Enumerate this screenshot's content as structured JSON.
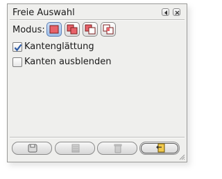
{
  "dialog": {
    "title": "Freie Auswahl",
    "modus_label": "Modus:",
    "modes": [
      {
        "icon": "replace-selection-icon",
        "active": true
      },
      {
        "icon": "add-to-selection-icon",
        "active": false
      },
      {
        "icon": "subtract-from-selection-icon",
        "active": false
      },
      {
        "icon": "intersect-selection-icon",
        "active": false
      }
    ],
    "antialiasing": {
      "label": "Kantenglättung",
      "checked": true
    },
    "feather": {
      "label": "Kanten ausblenden",
      "checked": false
    },
    "actions": [
      {
        "icon": "save-icon",
        "enabled": true
      },
      {
        "icon": "restore-icon",
        "enabled": false
      },
      {
        "icon": "delete-icon",
        "enabled": false
      },
      {
        "icon": "reset-icon",
        "enabled": true
      }
    ],
    "colors": {
      "accent": "#2b5aa6",
      "mode_fill": "#e8626a"
    }
  }
}
